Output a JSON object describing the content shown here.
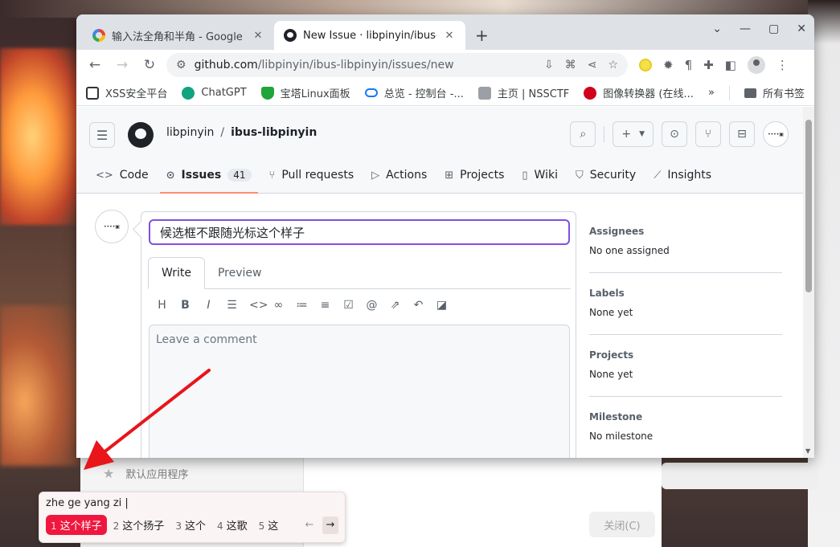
{
  "browser": {
    "tabs": [
      {
        "title": "输入法全角和半角 - Google 搜索",
        "active": false
      },
      {
        "title": "New Issue · libpinyin/ibus-libpinyin",
        "active": true
      }
    ],
    "url_host": "github.com",
    "url_path": "/libpinyin/ibus-libpinyin/issues/new",
    "bookmarks": [
      "XSS安全平台",
      "ChatGPT",
      "宝塔Linux面板",
      "总览 - 控制台 -...",
      "主页 | NSSCTF",
      "图像转换器 (在线..."
    ],
    "bookmarks_more": "»",
    "bookmarks_folder": "所有书签"
  },
  "github": {
    "owner": "libpinyin",
    "separator": "/",
    "repo": "ibus-libpinyin",
    "nav": [
      {
        "label": "Code",
        "icon": "code-icon"
      },
      {
        "label": "Issues",
        "icon": "issue-icon",
        "count": "41"
      },
      {
        "label": "Pull requests",
        "icon": "pull-request-icon"
      },
      {
        "label": "Actions",
        "icon": "play-icon"
      },
      {
        "label": "Projects",
        "icon": "table-icon"
      },
      {
        "label": "Wiki",
        "icon": "book-icon"
      },
      {
        "label": "Security",
        "icon": "shield-icon"
      },
      {
        "label": "Insights",
        "icon": "graph-icon"
      }
    ],
    "issue_title": "候选框不跟随光标这个样子",
    "editor_tabs": [
      "Write",
      "Preview"
    ],
    "comment_placeholder": "Leave a comment",
    "sidebar": [
      {
        "heading": "Assignees",
        "value": "No one assigned"
      },
      {
        "heading": "Labels",
        "value": "None yet"
      },
      {
        "heading": "Projects",
        "value": "None yet"
      },
      {
        "heading": "Milestone",
        "value": "No milestone"
      }
    ]
  },
  "background_dialog": {
    "default_app_label": "默认应用程序",
    "close_button": "关闭(C)"
  },
  "ime": {
    "preedit": "zhe ge yang zi |",
    "candidates": [
      {
        "num": "1",
        "text": "这个样子",
        "selected": true
      },
      {
        "num": "2",
        "text": "这个扬子",
        "selected": false
      },
      {
        "num": "3",
        "text": "这个",
        "selected": false
      },
      {
        "num": "4",
        "text": "这歌",
        "selected": false
      },
      {
        "num": "5",
        "text": "这",
        "selected": false
      }
    ]
  },
  "colors": {
    "accent_purple": "#8250df",
    "issues_underline": "#fd8c73",
    "ime_selected": "#f0173f",
    "annotation_arrow": "#e8151b"
  }
}
